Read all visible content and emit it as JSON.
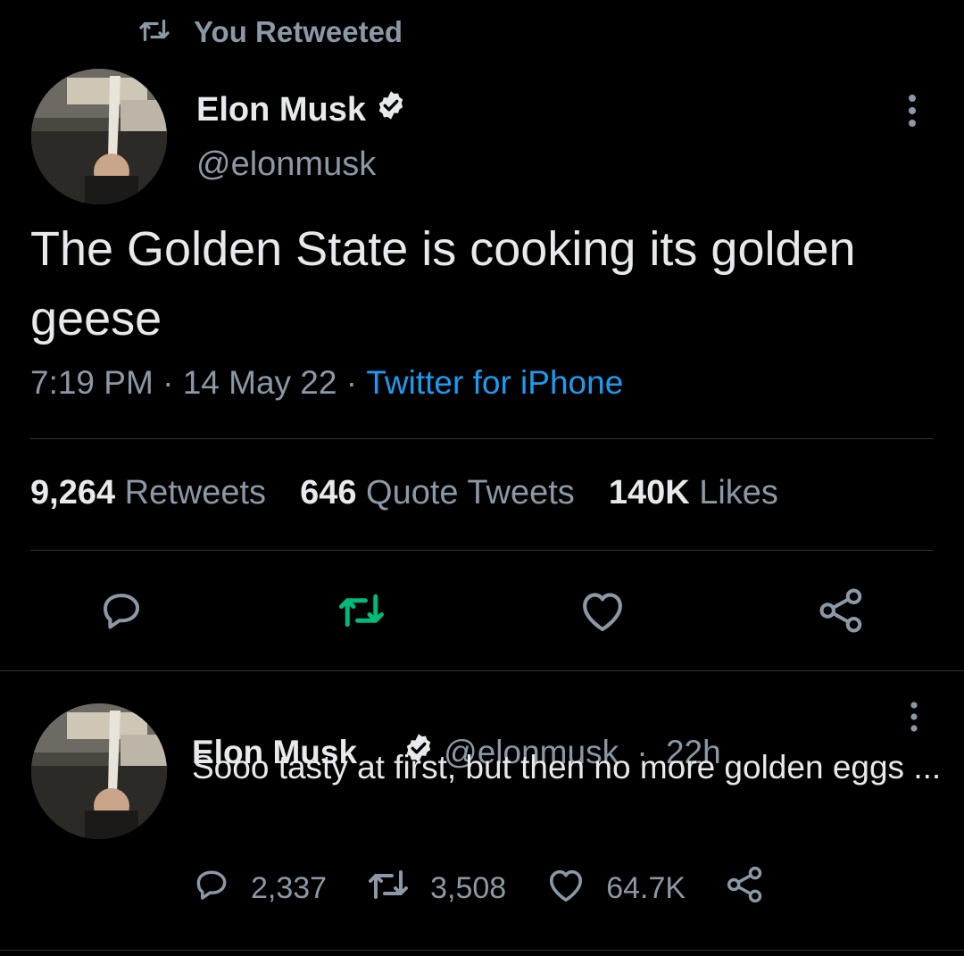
{
  "retweet_header": {
    "label": "You Retweeted",
    "icon": "retweet-icon"
  },
  "main_tweet": {
    "author": {
      "name": "Elon Musk",
      "handle": "@elonmusk",
      "verified": true
    },
    "text": "The Golden State is cooking its golden geese",
    "time": "7:19 PM",
    "separator": " · ",
    "date": "14 May 22",
    "source": "Twitter for iPhone",
    "stats": {
      "retweets_count": "9,264",
      "retweets_label": "Retweets",
      "quotes_count": "646",
      "quotes_label": "Quote Tweets",
      "likes_count": "140K",
      "likes_label": "Likes"
    },
    "actions": [
      "reply-icon",
      "retweet-icon",
      "like-icon",
      "share-icon"
    ]
  },
  "reply_tweet": {
    "author": {
      "name": "Elon Musk",
      "handle": "@elonmusk",
      "verified": true
    },
    "separator": " · ",
    "age": "22h",
    "text": "Sooo tasty at first, but then no more golden eggs ...",
    "replies": "2,337",
    "retweets": "3,508",
    "likes": "64.7K"
  },
  "colors": {
    "background": "#000000",
    "text": "#e7e9ea",
    "secondary": "#8b98a5",
    "link": "#1d9bf0",
    "retweeted_green": "#00ba7c",
    "divider": "#2f3336"
  }
}
